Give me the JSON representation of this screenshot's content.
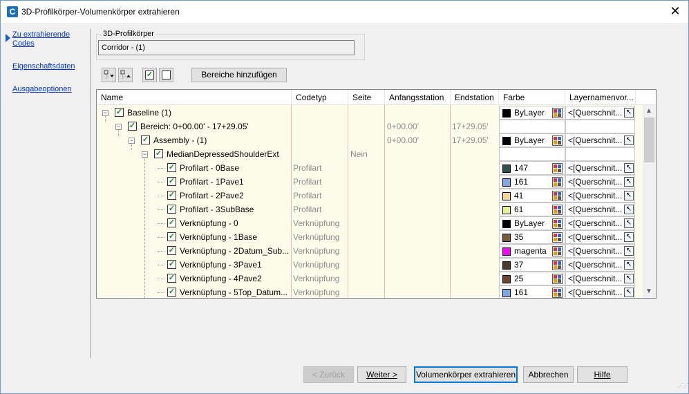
{
  "window": {
    "title": "3D-Profilkörper-Volumenkörper extrahieren",
    "close": "✕",
    "app_icon_letter": "C"
  },
  "nav": {
    "items": [
      {
        "label": "Zu extrahierende Codes",
        "active": true
      },
      {
        "label": "Eigenschaftsdaten",
        "active": false
      },
      {
        "label": "Ausgabeoptionen",
        "active": false
      }
    ]
  },
  "group": {
    "legend": "3D-Profilkörper",
    "value": "Corridor - (1)"
  },
  "toolbar": {
    "add_regions_label": "Bereiche hinzufügen",
    "check": "✓"
  },
  "grid": {
    "columns": [
      "Name",
      "Codetyp",
      "Seite",
      "Anfangsstation",
      "Endstation",
      "Farbe",
      "Layernamenvor..."
    ],
    "rows": [
      {
        "name": "Baseline (1)",
        "codetyp": "",
        "seite": "",
        "anfang": "",
        "end": "",
        "farbe": "ByLayer",
        "color": "#000000",
        "layer": "<[Querschnit...",
        "level": 0
      },
      {
        "name": "Bereich: 0+00.00' - 17+29.05'",
        "codetyp": "",
        "seite": "",
        "anfang": "0+00.00'",
        "end": "17+29.05'",
        "farbe": "",
        "color": "",
        "layer": "",
        "level": 1
      },
      {
        "name": "Assembly - (1)",
        "codetyp": "",
        "seite": "",
        "anfang": "0+00.00'",
        "end": "17+29.05'",
        "farbe": "ByLayer",
        "color": "#000000",
        "layer": "<[Querschnit...",
        "level": 2
      },
      {
        "name": "MedianDepressedShoulderExt",
        "codetyp": "",
        "seite": "Nein",
        "anfang": "",
        "end": "",
        "farbe": "",
        "color": "",
        "layer": "",
        "level": 3
      },
      {
        "name": "Profilart - 0Base",
        "codetyp": "Profilart",
        "seite": "",
        "anfang": "",
        "end": "",
        "farbe": "147",
        "color": "#2f4f4f",
        "layer": "<[Querschnit...",
        "level": 4
      },
      {
        "name": "Profilart - 1Pave1",
        "codetyp": "Profilart",
        "seite": "",
        "anfang": "",
        "end": "",
        "farbe": "161",
        "color": "#7ea6ea",
        "layer": "<[Querschnit...",
        "level": 4
      },
      {
        "name": "Profilart - 2Pave2",
        "codetyp": "Profilart",
        "seite": "",
        "anfang": "",
        "end": "",
        "farbe": "41",
        "color": "#f6d58f",
        "layer": "<[Querschnit...",
        "level": 4
      },
      {
        "name": "Profilart - 3SubBase",
        "codetyp": "Profilart",
        "seite": "",
        "anfang": "",
        "end": "",
        "farbe": "61",
        "color": "#e4f58c",
        "layer": "<[Querschnit...",
        "level": 4
      },
      {
        "name": "Verknüpfung - 0",
        "codetyp": "Verknüpfung",
        "seite": "",
        "anfang": "",
        "end": "",
        "farbe": "ByLayer",
        "color": "#000000",
        "layer": "<[Querschnit...",
        "level": 4
      },
      {
        "name": "Verknüpfung - 1Base",
        "codetyp": "Verknüpfung",
        "seite": "",
        "anfang": "",
        "end": "",
        "farbe": "35",
        "color": "#7a5a3a",
        "layer": "<[Querschnit...",
        "level": 4
      },
      {
        "name": "Verknüpfung - 2Datum_Sub...",
        "codetyp": "Verknüpfung",
        "seite": "",
        "anfang": "",
        "end": "",
        "farbe": "magenta",
        "color": "#ff00ff",
        "layer": "<[Querschnit...",
        "level": 4
      },
      {
        "name": "Verknüpfung - 3Pave1",
        "codetyp": "Verknüpfung",
        "seite": "",
        "anfang": "",
        "end": "",
        "farbe": "37",
        "color": "#4d3a2a",
        "layer": "<[Querschnit...",
        "level": 4
      },
      {
        "name": "Verknüpfung - 4Pave2",
        "codetyp": "Verknüpfung",
        "seite": "",
        "anfang": "",
        "end": "",
        "farbe": "25",
        "color": "#6b4532",
        "layer": "<[Querschnit...",
        "level": 4
      },
      {
        "name": "Verknüpfung - 5Top_Datum...",
        "codetyp": "Verknüpfung",
        "seite": "",
        "anfang": "",
        "end": "",
        "farbe": "161",
        "color": "#7ea6ea",
        "layer": "<[Querschnit...",
        "level": 4
      }
    ]
  },
  "buttons": {
    "back": "< Zurück",
    "next": "Weiter >",
    "extract": "Volumenkörper extrahieren",
    "cancel": "Abbrechen",
    "help": "Hilfe"
  }
}
